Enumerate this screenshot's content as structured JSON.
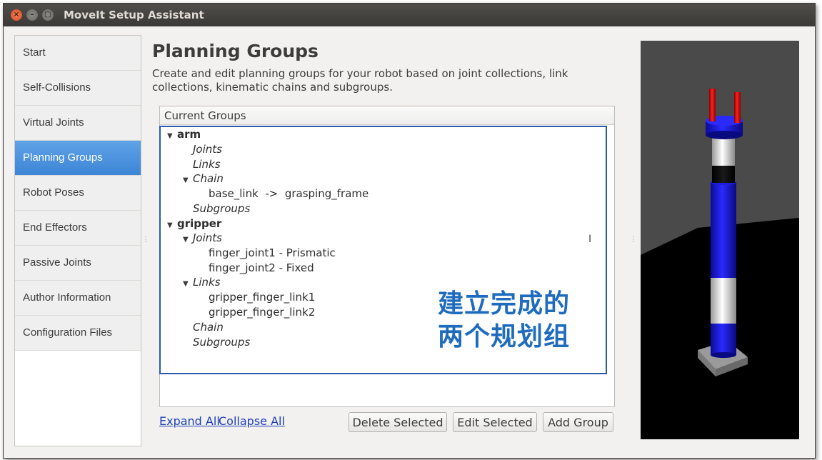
{
  "window": {
    "title": "MoveIt Setup Assistant",
    "buttons": {
      "close": "×",
      "minimize": "–",
      "maximize": "□"
    }
  },
  "sidebar": {
    "items": [
      {
        "label": "Start"
      },
      {
        "label": "Self-Collisions"
      },
      {
        "label": "Virtual Joints"
      },
      {
        "label": "Planning Groups",
        "active": true
      },
      {
        "label": "Robot Poses"
      },
      {
        "label": "End Effectors"
      },
      {
        "label": "Passive Joints"
      },
      {
        "label": "Author Information"
      },
      {
        "label": "Configuration Files"
      }
    ]
  },
  "main": {
    "title": "Planning Groups",
    "description": "Create and edit planning groups for your robot based on joint collections, link collections, kinematic chains and subgroups.",
    "groups_header": "Current Groups",
    "tree": [
      {
        "label": "arm",
        "arrow": "▼"
      },
      {
        "label": "Joints"
      },
      {
        "label": "Links"
      },
      {
        "label": "Chain",
        "arrow": "▼"
      },
      {
        "label": "base_link  ->  grasping_frame"
      },
      {
        "label": "Subgroups"
      },
      {
        "label": "gripper",
        "arrow": "▼"
      },
      {
        "label": "Joints",
        "arrow": "▼"
      },
      {
        "label": "finger_joint1 - Prismatic"
      },
      {
        "label": "finger_joint2 - Fixed"
      },
      {
        "label": "Links",
        "arrow": "▼"
      },
      {
        "label": "gripper_finger_link1"
      },
      {
        "label": "gripper_finger_link2"
      },
      {
        "label": "Chain"
      },
      {
        "label": "Subgroups"
      }
    ],
    "overlay_line1": "建立完成的",
    "overlay_line2": "两个规划组"
  },
  "footer": {
    "expand_all": "Expand All",
    "collapse_all": "Collapse All",
    "delete_selected": "Delete Selected",
    "edit_selected": "Edit Selected",
    "add_group": "Add Group"
  },
  "icons": {
    "cursor": "I"
  },
  "colors": {
    "active_nav": "#3d85d6",
    "tree_border": "#2a5aa8",
    "overlay_text": "#1f6cbf",
    "robot_blue": "#1616d8",
    "robot_red": "#e01010"
  }
}
